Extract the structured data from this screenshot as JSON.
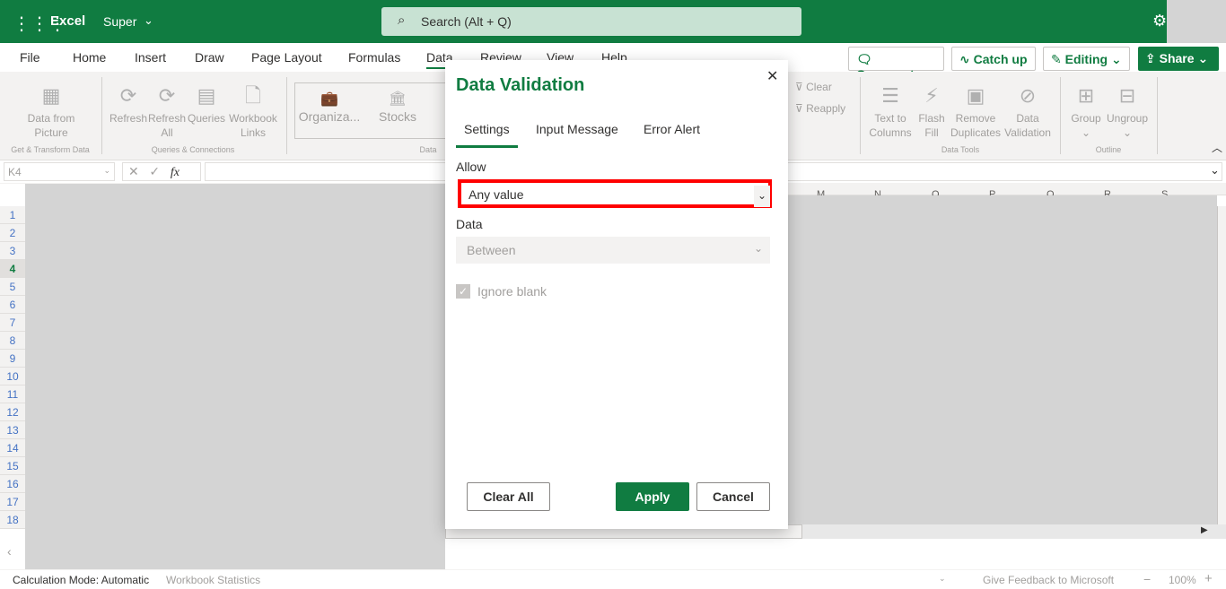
{
  "app": {
    "waffle_icon": "waffle-icon",
    "name": "Excel",
    "doc_name": "Super",
    "search_placeholder": "Search (Alt + Q)"
  },
  "tabs": [
    "File",
    "Home",
    "Insert",
    "Draw",
    "Page Layout",
    "Formulas",
    "Data",
    "Review",
    "View",
    "Help"
  ],
  "active_tab": "Data",
  "top_buttons": {
    "comments": "Comments",
    "catch_up": "Catch up",
    "editing": "Editing",
    "share": "Share"
  },
  "ribbon": {
    "data_from_picture": "Data from Picture",
    "refresh": "Refresh",
    "refresh_all": "Refresh All",
    "queries": "Queries",
    "workbook_links": "Workbook Links",
    "organiza": "Organiza...",
    "stocks": "Stocks",
    "clear": "Clear",
    "reapply": "Reapply",
    "text_to_columns": "Text to Columns",
    "flash_fill": "Flash Fill",
    "remove_duplicates": "Remove Duplicates",
    "data_validation": "Data Validation",
    "group": "Group",
    "ungroup": "Ungroup",
    "groups": {
      "get_transform": "Get & Transform Data",
      "queries_connections": "Queries & Connections",
      "data_types": "Data",
      "data_tools": "Data Tools",
      "outline": "Outline"
    }
  },
  "formula_bar": {
    "name_box": "K4",
    "fx": "fx",
    "value": ""
  },
  "columns": [
    "M",
    "N",
    "O",
    "P",
    "Q",
    "R",
    "S"
  ],
  "rows": [
    "1",
    "2",
    "3",
    "4",
    "5",
    "6",
    "7",
    "8",
    "9",
    "10",
    "11",
    "12",
    "13",
    "14",
    "15",
    "16",
    "17",
    "18"
  ],
  "active_row": "4",
  "dialog": {
    "title": "Data Validation",
    "tabs": [
      "Settings",
      "Input Message",
      "Error Alert"
    ],
    "allow_label": "Allow",
    "allow_value": "Any value",
    "data_label": "Data",
    "data_value": "Between",
    "ignore_blank": "Ignore blank",
    "ignore_blank_checked": true,
    "clear_all": "Clear All",
    "apply": "Apply",
    "cancel": "Cancel"
  },
  "status": {
    "calc_mode": "Calculation Mode: Automatic",
    "workbook_stats": "Workbook Statistics",
    "feedback": "Give Feedback to Microsoft",
    "zoom": "100%"
  },
  "colors": {
    "brand": "#107c41",
    "highlight": "#ff0000"
  }
}
